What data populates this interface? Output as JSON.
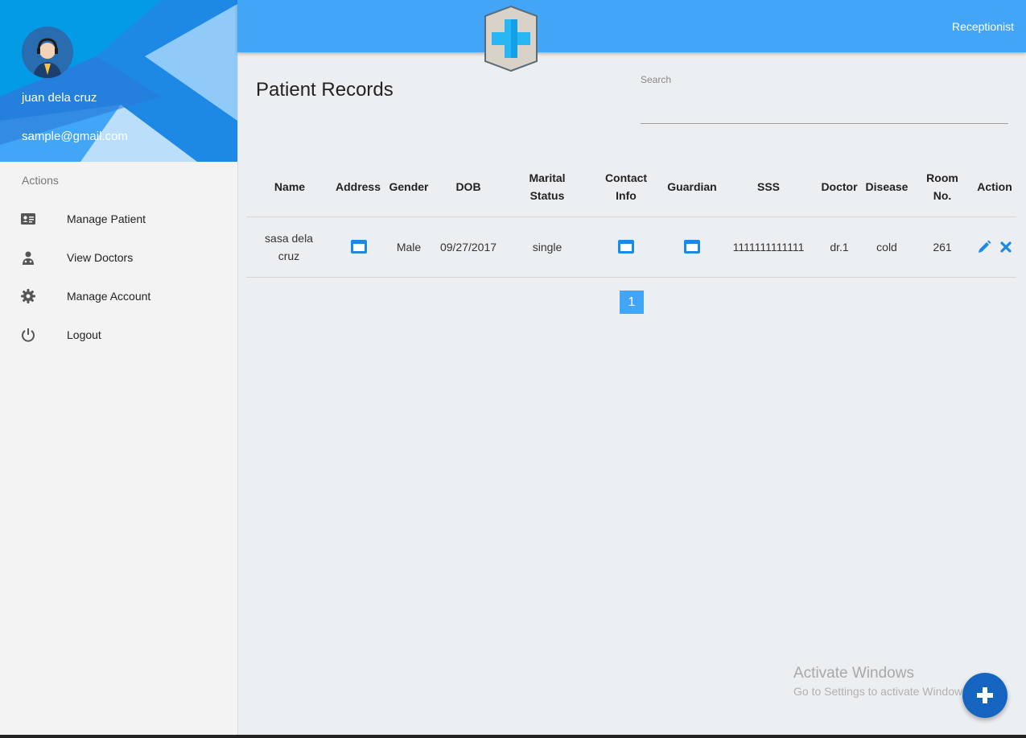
{
  "user": {
    "name": "juan dela cruz",
    "email": "sample@gmail.com"
  },
  "header": {
    "role": "Receptionist"
  },
  "sidebar": {
    "section_label": "Actions",
    "items": [
      {
        "label": "Manage Patient",
        "icon": "id-card-icon"
      },
      {
        "label": "View Doctors",
        "icon": "doctor-icon"
      },
      {
        "label": "Manage Account",
        "icon": "gear-icon"
      },
      {
        "label": "Logout",
        "icon": "power-icon"
      }
    ]
  },
  "main": {
    "title": "Patient Records",
    "search": {
      "label": "Search",
      "value": ""
    }
  },
  "table": {
    "headers": {
      "name": "Name",
      "address": "Address",
      "gender": "Gender",
      "dob": "DOB",
      "marital_1": "Marital",
      "marital_2": "Status",
      "contact_1": "Contact",
      "contact_2": "Info",
      "guardian": "Guardian",
      "sss": "SSS",
      "doctor": "Doctor",
      "disease": "Disease",
      "room_1": "Room",
      "room_2": "No.",
      "action": "Action"
    },
    "rows": [
      {
        "name_1": "sasa dela",
        "name_2": "cruz",
        "gender": "Male",
        "dob": "09/27/2017",
        "marital": "single",
        "sss": "1111111111111",
        "doctor": "dr.1",
        "disease": "cold",
        "room": "261"
      }
    ]
  },
  "pagination": {
    "current": "1"
  },
  "watermark": {
    "line1": "Activate Windows",
    "line2": "Go to Settings to activate Windows."
  },
  "colors": {
    "accent": "#42a5f5",
    "icon_blue": "#1e88e5",
    "fab": "#1565c0"
  }
}
